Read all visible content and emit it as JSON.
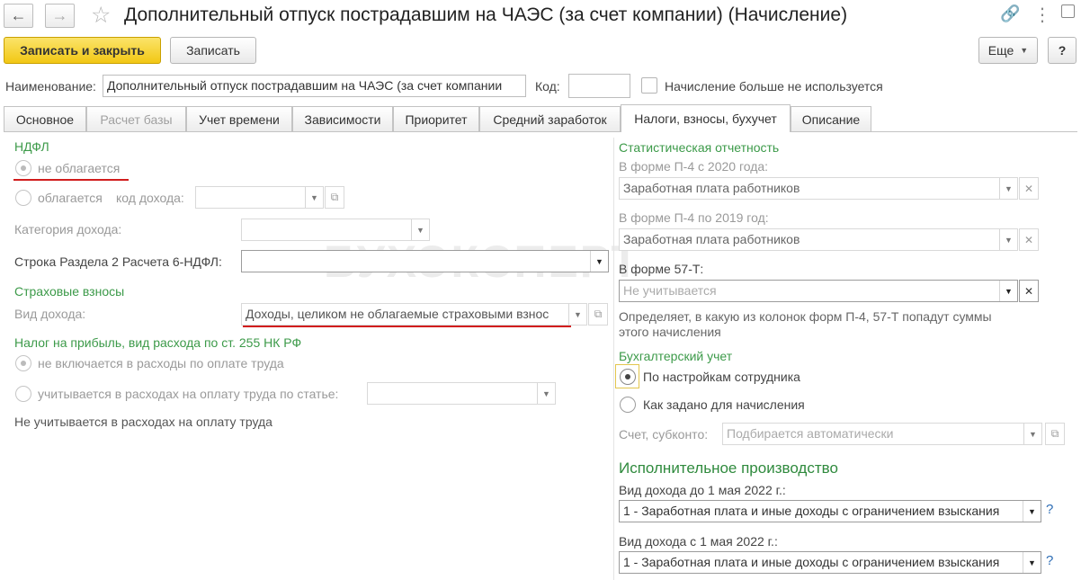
{
  "window": {
    "title": "Дополнительный отпуск пострадавшим на ЧАЭС (за счет компании) (Начисление)"
  },
  "nav": {
    "back_icon": "arrow-left-icon",
    "forward_icon": "arrow-right-icon",
    "star_icon": "star-icon"
  },
  "window_icons": {
    "link": "link-icon",
    "more": "more-vertical-icon",
    "maximize": "maximize-icon",
    "close": "close-icon"
  },
  "toolbar": {
    "save_close_label": "Записать и закрыть",
    "save_label": "Записать",
    "more_label": "Еще",
    "help_label": "?"
  },
  "header": {
    "name_label": "Наименование:",
    "name_value": "Дополнительный отпуск пострадавшим на ЧАЭС (за счет компании",
    "code_label": "Код:",
    "code_value": "",
    "unused_label": "Начисление больше не используется"
  },
  "tabs": [
    {
      "label": "Основное"
    },
    {
      "label": "Расчет базы"
    },
    {
      "label": "Учет времени"
    },
    {
      "label": "Зависимости"
    },
    {
      "label": "Приоритет"
    },
    {
      "label": "Средний заработок"
    },
    {
      "label": "Налоги, взносы, бухучет"
    },
    {
      "label": "Описание"
    }
  ],
  "ndfl": {
    "header": "НДФЛ",
    "not_taxed": "не облагается",
    "taxed": "облагается",
    "income_code_label": "код дохода:",
    "income_code_value": "",
    "income_category_label": "Категория дохода:",
    "income_category_value": "",
    "row_6ndfl_label": "Строка Раздела 2 Расчета 6-НДФЛ:",
    "row_6ndfl_value": ""
  },
  "insurance": {
    "header": "Страховые взносы",
    "income_type_label": "Вид дохода:",
    "income_type_value": "Доходы, целиком не облагаемые страховыми взнос"
  },
  "profit_tax": {
    "header": "Налог на прибыль, вид расхода по ст. 255 НК РФ",
    "not_included": "не включается в расходы по оплате труда",
    "included_by_article": "учитывается в расходах на оплату труда по статье:",
    "article_value": "",
    "note": "Не учитывается в расходах на оплату труда"
  },
  "stats": {
    "header": "Статистическая отчетность",
    "p4_2020_label": "В форме П-4 с 2020 года:",
    "p4_2020_value": "Заработная плата работников",
    "p4_2019_label": "В форме П-4 по 2019 год:",
    "p4_2019_value": "Заработная плата работников",
    "f57t_label": "В форме 57-Т:",
    "f57t_placeholder": "Не учитывается",
    "description_line1": "Определяет, в какую из колонок форм П-4, 57-Т попадут суммы",
    "description_line2": "этого начисления"
  },
  "accounting": {
    "header": "Бухгалтерский учет",
    "by_employee": "По настройкам сотрудника",
    "as_set": "Как задано для начисления",
    "account_label": "Счет, субконто:",
    "account_placeholder": "Подбирается автоматически"
  },
  "enforcement": {
    "header": "Исполнительное производство",
    "before_label": "Вид дохода до 1 мая 2022 г.:",
    "before_value": "1 - Заработная плата и иные доходы с ограничением взыскания",
    "after_label": "Вид дохода с 1 мая 2022 г.:",
    "after_value": "1 - Заработная плата и иные доходы с ограничением взыскания",
    "help": "?"
  },
  "watermark": "БУХЭКСПЕРТ",
  "colors": {
    "accent_green": "#3c9a49",
    "primary_yellow": "#f2c714",
    "red_underline": "#d11d1d"
  }
}
